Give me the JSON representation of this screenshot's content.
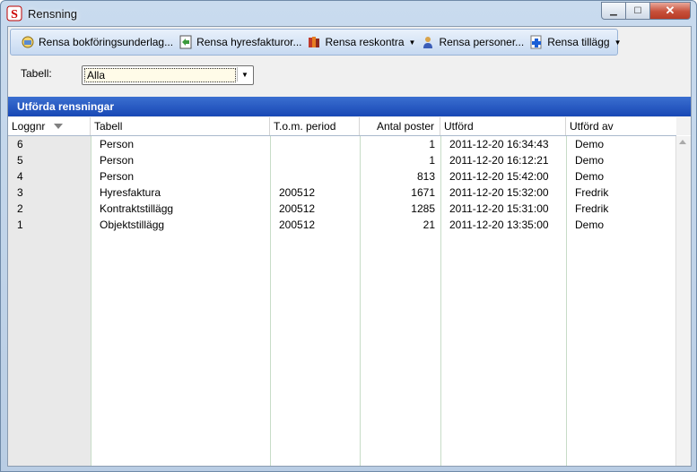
{
  "window": {
    "title": "Rensning"
  },
  "toolbar": {
    "items": [
      {
        "label": "Rensa bokföringsunderlag...",
        "icon": "accounting-icon",
        "dropdown": false
      },
      {
        "label": "Rensa hyresfakturor...",
        "icon": "invoice-icon",
        "dropdown": false
      },
      {
        "label": "Rensa reskontra",
        "icon": "ledger-books-icon",
        "dropdown": true
      },
      {
        "label": "Rensa personer...",
        "icon": "person-icon",
        "dropdown": false
      },
      {
        "label": "Rensa tillägg",
        "icon": "plus-document-icon",
        "dropdown": true
      }
    ]
  },
  "filter": {
    "label": "Tabell:",
    "value": "Alla"
  },
  "section": {
    "title": "Utförda rensningar"
  },
  "table": {
    "columns": [
      "Loggnr",
      "Tabell",
      "T.o.m. period",
      "Antal poster",
      "Utförd",
      "Utförd av"
    ],
    "rows": [
      [
        "6",
        "Person",
        "",
        "1",
        "2011-12-20 16:34:43",
        "Demo"
      ],
      [
        "5",
        "Person",
        "",
        "1",
        "2011-12-20 16:12:21",
        "Demo"
      ],
      [
        "4",
        "Person",
        "",
        "813",
        "2011-12-20 15:42:00",
        "Demo"
      ],
      [
        "3",
        "Hyresfaktura",
        "200512",
        "1671",
        "2011-12-20 15:32:00",
        "Fredrik"
      ],
      [
        "2",
        "Kontraktstillägg",
        "200512",
        "1285",
        "2011-12-20 15:31:00",
        "Fredrik"
      ],
      [
        "1",
        "Objektstillägg",
        "200512",
        "21",
        "2011-12-20 13:35:00",
        "Demo"
      ]
    ]
  },
  "colors": {
    "header_blue": "#1848b5",
    "toolbar_blue": "#c6d9f1"
  }
}
